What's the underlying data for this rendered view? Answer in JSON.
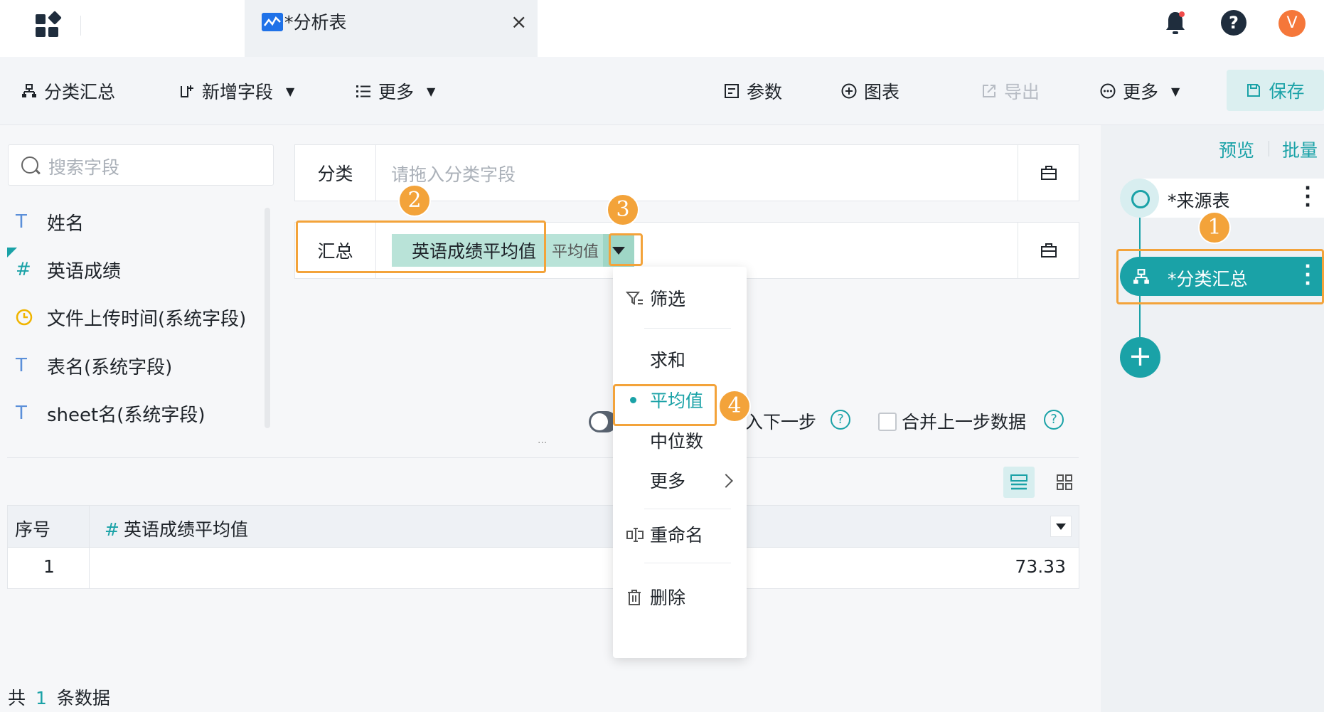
{
  "tab": {
    "title": "*分析表",
    "close": "×"
  },
  "topbar": {
    "avatar_letter": "V",
    "help_label": "?"
  },
  "toolbar": {
    "group_summary": "分类汇总",
    "add_field": "新增字段",
    "more_left": "更多",
    "params": "参数",
    "chart": "图表",
    "export": "导出",
    "more_right": "更多",
    "save": "保存"
  },
  "search": {
    "placeholder": "搜索字段"
  },
  "fields": [
    {
      "type": "T",
      "name": "姓名",
      "type_color": "#5b8fd9"
    },
    {
      "type": "#",
      "name": "英语成绩",
      "type_color": "#1aa2a7"
    },
    {
      "type": "clock",
      "name": "文件上传时间(系统字段)",
      "type_color": "#f0b400"
    },
    {
      "type": "T",
      "name": "表名(系统字段)",
      "type_color": "#5b8fd9"
    },
    {
      "type": "T",
      "name": "sheet名(系统字段)",
      "type_color": "#5b8fd9"
    }
  ],
  "config": {
    "category_label": "分类",
    "category_placeholder": "请拖入分类字段",
    "summary_label": "汇总",
    "summary_field": "英语成绩平均值",
    "summary_agg": "平均值"
  },
  "options": {
    "opt1_visible": "入下一步",
    "opt2": "合并上一步数据"
  },
  "table": {
    "headers": [
      "序号",
      "英语成绩平均值"
    ],
    "header_type": "#",
    "rows": [
      {
        "seq": "1",
        "value": "73.33"
      }
    ]
  },
  "footer": {
    "prefix": "共",
    "count": "1",
    "suffix": "条数据"
  },
  "flow": {
    "preview": "预览",
    "batch": "批量",
    "source_node": "*来源表",
    "current_node": "*分类汇总",
    "add": "+"
  },
  "menu": {
    "filter": "筛选",
    "sum": "求和",
    "avg": "平均值",
    "median": "中位数",
    "more": "更多",
    "rename": "重命名",
    "delete": "删除"
  },
  "badges": [
    "1",
    "2",
    "3",
    "4"
  ],
  "colors": {
    "accent": "#1aa2a7",
    "highlight": "#f3a33a",
    "chip": "#b9e3d8"
  }
}
